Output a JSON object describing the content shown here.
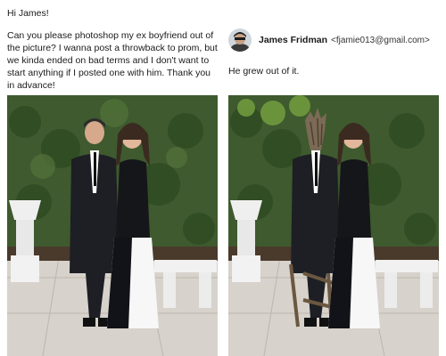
{
  "request_message": {
    "greeting": "Hi James!",
    "body": "Can you please photoshop my ex boyfriend out of the picture? I wanna post a throwback to prom, but we kinda ended on bad terms and I don't want to start anything if I posted one with him. Thank you in advance!"
  },
  "reply_message": {
    "sender_name": "James Fridman",
    "sender_email": "<fjamie013@gmail.com>",
    "body": "He grew out of it."
  },
  "photos": {
    "original": {
      "icon": "prom-photo-couple"
    },
    "edited": {
      "icon": "prom-photo-tree-man"
    }
  }
}
